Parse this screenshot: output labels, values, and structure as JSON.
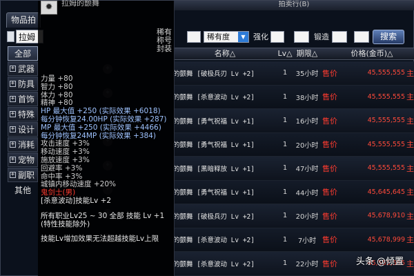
{
  "window": {
    "title": "拍卖行(B)"
  },
  "tabs": [
    {
      "label": "物品拍"
    }
  ],
  "sidebar": {
    "search_value": "拉姆",
    "categories": [
      {
        "label": "全部",
        "expandable": false,
        "active": true
      },
      {
        "label": "武器",
        "expandable": true
      },
      {
        "label": "防具",
        "expandable": true
      },
      {
        "label": "首饰",
        "expandable": true
      },
      {
        "label": "特殊",
        "expandable": true
      },
      {
        "label": "设计",
        "expandable": true
      },
      {
        "label": "消耗",
        "expandable": true
      },
      {
        "label": "宠物",
        "expandable": true
      },
      {
        "label": "副职",
        "expandable": true
      },
      {
        "label": "其他",
        "expandable": false
      }
    ]
  },
  "filters": {
    "rarity_select": "稀有度",
    "enhance_label": "强化",
    "refine_label": "锻造",
    "search_button": "搜索"
  },
  "table": {
    "headers": {
      "name": "名称△",
      "level": "Lv△",
      "time": "期限△",
      "price": "价格(金币)△"
    },
    "rows": [
      {
        "name": "的颤舞 [破极兵刃 Lv +2]",
        "level": "1",
        "time": "35小时",
        "tag": "售价",
        "price": "45,555,555",
        "extra": "主"
      },
      {
        "name": "的颤舞 [杀意波动 Lv +2]",
        "level": "1",
        "time": "38小时",
        "tag": "售价",
        "price": "45,555,555",
        "extra": "主"
      },
      {
        "name": "的颤舞 [勇气祝福 Lv +1]",
        "level": "1",
        "time": "16小时",
        "tag": "售价",
        "price": "45,555,555",
        "extra": "主"
      },
      {
        "name": "的颤舞 [勇气祝福 Lv +1]",
        "level": "1",
        "time": "20小时",
        "tag": "售价",
        "price": "45,555,555",
        "extra": "主"
      },
      {
        "name": "的颤舞 [黑暗释放 Lv +1]",
        "level": "1",
        "time": "47小时",
        "tag": "售价",
        "price": "45,555,555",
        "extra": "主"
      },
      {
        "name": "的颤舞 [勇气祝福 Lv +1]",
        "level": "1",
        "time": "44小时",
        "tag": "售价",
        "price": "45,645,645",
        "extra": "主"
      },
      {
        "name": "的颤舞 [破极兵刃 Lv +2]",
        "level": "1",
        "time": "20小时",
        "tag": "售价",
        "price": "45,678,910",
        "extra": "主"
      },
      {
        "name": "的颤舞 [杀意波动 Lv +2]",
        "level": "1",
        "time": "7小时",
        "tag": "售价",
        "price": "45,678,999",
        "extra": "主"
      },
      {
        "name": "的颤舞 [杀意波动 Lv +2]",
        "level": "1",
        "time": "22小时",
        "tag": "售价",
        "price": "45,555,555",
        "extra": "主"
      }
    ]
  },
  "tooltip": {
    "title": "拉姆的颤舞",
    "side_tag": "稀有称号封装",
    "lines": [
      {
        "text": "力量 +80",
        "kind": "stat"
      },
      {
        "text": "智力 +80",
        "kind": "stat"
      },
      {
        "text": "体力 +80",
        "kind": "stat"
      },
      {
        "text": "精神 +80",
        "kind": "stat"
      },
      {
        "text": "HP 最大值 +250 (实际效果 +6018)",
        "kind": "mp"
      },
      {
        "text": "每分钟恢复24.00HP (实际效果 +287)",
        "kind": "mp"
      },
      {
        "text": "MP 最大值 +250 (实际效果 +4466)",
        "kind": "mp"
      },
      {
        "text": "每分钟恢复24MP (实际效果 +384)",
        "kind": "mp"
      },
      {
        "text": "攻击速度 +3%",
        "kind": "stat"
      },
      {
        "text": "移动速度 +3%",
        "kind": "stat"
      },
      {
        "text": "施放速度 +3%",
        "kind": "stat"
      },
      {
        "text": "回避率 +3%",
        "kind": "stat"
      },
      {
        "text": "命中率 +3%",
        "kind": "stat"
      },
      {
        "text": "城镇内移动速度 +20%",
        "kind": "stat"
      },
      {
        "text": "鬼剑士(男)",
        "kind": "red"
      },
      {
        "text": "[杀意波动]技能Lv +2",
        "kind": "skill"
      },
      {
        "text": "",
        "kind": "gap"
      },
      {
        "text": "所有职业Lv25 ~ 30 全部 技能 Lv +1",
        "kind": "skill"
      },
      {
        "text": "(特性技能除外)",
        "kind": "skill"
      },
      {
        "text": "",
        "kind": "gap"
      },
      {
        "text": "技能Lv增加效果无法超越技能Lv上限",
        "kind": "skill"
      }
    ]
  },
  "watermark": "头条 @倾置"
}
